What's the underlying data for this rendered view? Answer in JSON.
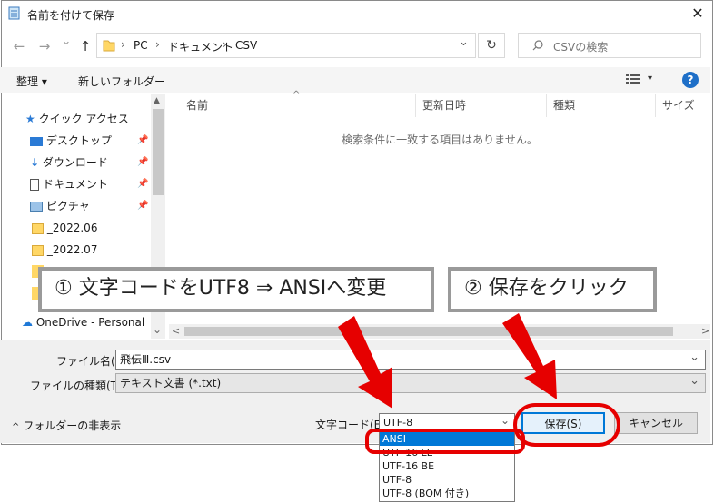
{
  "window": {
    "title": "名前を付けて保存",
    "close_glyph": "✕"
  },
  "nav": {
    "back_glyph": "←",
    "forward_glyph": "→",
    "history_glyph": "⌄",
    "up_glyph": "↑",
    "breadcrumb": [
      "PC",
      "ドキュメント",
      "CSV"
    ],
    "separator": "›",
    "addr_dropdown": "⌄",
    "refresh_glyph": "↻",
    "search_placeholder": "CSVの検索"
  },
  "toolbar": {
    "organize": "整理 ▾",
    "new_folder": "新しいフォルダー",
    "view_glyph": "▾",
    "help_glyph": "?"
  },
  "sidebar": {
    "items": [
      {
        "label": "クイック アクセス",
        "icon": "star-icon"
      },
      {
        "label": "デスクトップ",
        "icon": "desktop-icon",
        "pin": "📌"
      },
      {
        "label": "ダウンロード",
        "icon": "download-icon",
        "pin": "📌"
      },
      {
        "label": "ドキュメント",
        "icon": "document-icon",
        "pin": "📌"
      },
      {
        "label": "ピクチャ",
        "icon": "picture-icon",
        "pin": "📌"
      },
      {
        "label": "_2022.06",
        "icon": "folder-icon"
      },
      {
        "label": "_2022.07",
        "icon": "folder-icon"
      },
      {
        "label": "OneDrive - Personal",
        "icon": "cloud-icon"
      }
    ],
    "scroll_down": "⌄"
  },
  "list": {
    "columns": [
      "名前",
      "更新日時",
      "種類",
      "サイズ"
    ],
    "sort_indicator": "^",
    "empty_message": "検索条件に一致する項目はありません。",
    "scroll_left": "<",
    "scroll_right": ">"
  },
  "form": {
    "filename_label": "ファイル名(N):",
    "filename_value": "飛伝Ⅲ.csv",
    "filetype_label": "ファイルの種類(T):",
    "filetype_value": "テキスト文書 (*.txt)",
    "hide_folders": "フォルダーの非表示",
    "hide_glyph": "^",
    "encoding_label": "文字コード(E):",
    "encoding_value": "UTF-8",
    "encoding_options": [
      "ANSI",
      "UTF-16 LE",
      "UTF-16 BE",
      "UTF-8",
      "UTF-8 (BOM 付き)"
    ],
    "save_button": "保存(S)",
    "cancel_button": "キャンセル"
  },
  "annotations": {
    "callout_1": "① 文字コードをUTF8 ⇒ ANSIへ変更",
    "callout_2": "② 保存をクリック"
  },
  "colors": {
    "accent": "#0078d7",
    "annotation_red": "#e60000",
    "panel_bg": "#f0f0f0",
    "callout_border": "#9a9a9a"
  }
}
